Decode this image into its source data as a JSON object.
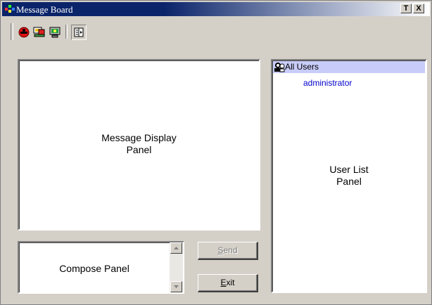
{
  "window": {
    "title": "Message Board",
    "title_button_1": "T",
    "title_button_2": "X"
  },
  "toolbar": {
    "buttons": [
      {
        "icon": "red-circle-icon",
        "pressed": false
      },
      {
        "icon": "computer-group-icon",
        "pressed": false
      },
      {
        "icon": "computer-icon",
        "pressed": false
      },
      {
        "icon": "panel-toggle-icon",
        "pressed": true
      }
    ]
  },
  "message_display": {
    "label_line1": "Message Display",
    "label_line2": "Panel"
  },
  "user_list": {
    "header": "All Users",
    "users": [
      "administrator"
    ],
    "label_line1": "User List",
    "label_line2": "Panel",
    "header_bg": "#c8ccf8",
    "user_color": "#0000cc"
  },
  "compose": {
    "label": "Compose Panel"
  },
  "buttons": {
    "send_label_first": "S",
    "send_label_rest": "end",
    "exit_label_first": "E",
    "exit_label_rest": "xit"
  },
  "colors": {
    "title_bar": "#0a246a",
    "face": "#d4d0c8"
  }
}
